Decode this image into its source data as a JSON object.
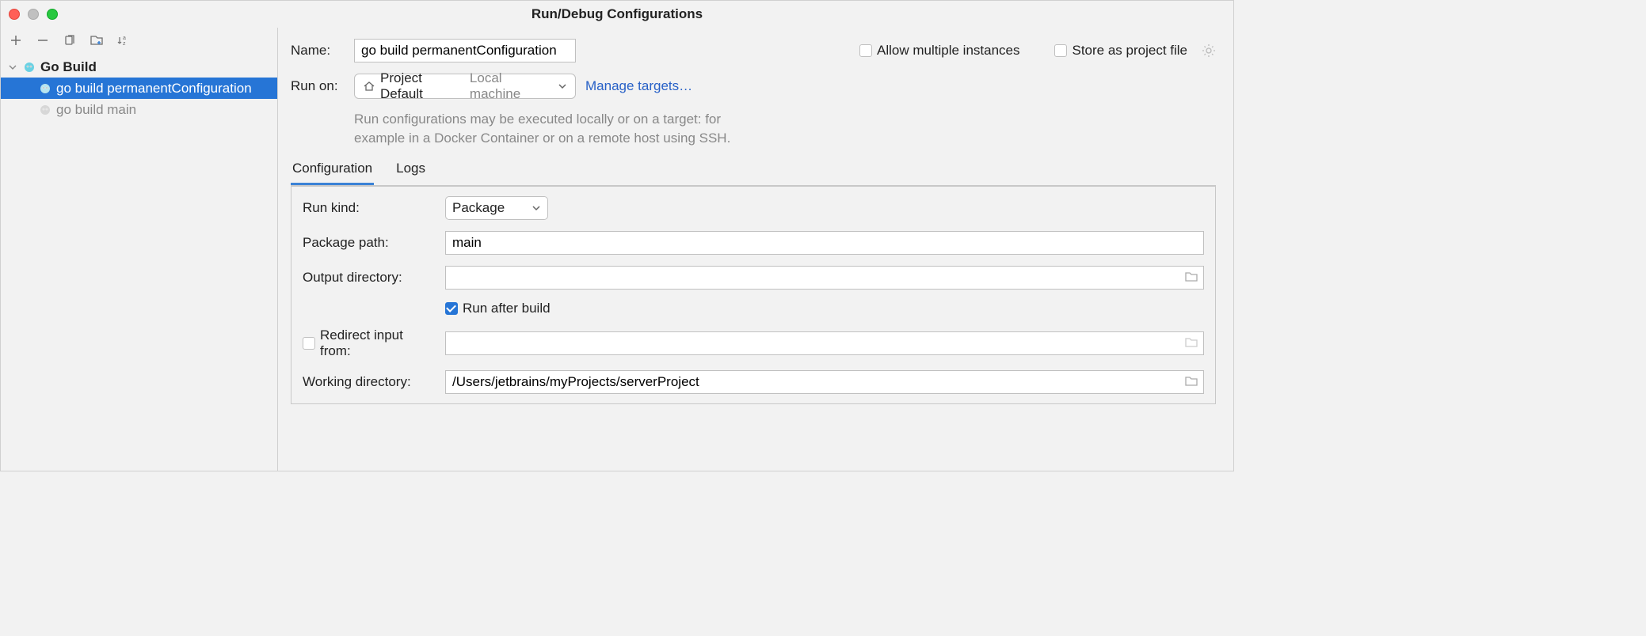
{
  "title": "Run/Debug Configurations",
  "sidebar": {
    "group": "Go Build",
    "items": [
      {
        "label": "go build permanentConfiguration",
        "selected": true
      },
      {
        "label": "go build main",
        "selected": false
      }
    ]
  },
  "form": {
    "name_label": "Name:",
    "name_value": "go build permanentConfiguration",
    "allow_multi": "Allow multiple instances",
    "store_project": "Store as project file",
    "run_on_label": "Run on:",
    "run_on_primary": "Project Default",
    "run_on_secondary": "Local machine",
    "manage_targets": "Manage targets…",
    "hint_l1": "Run configurations may be executed locally or on a target: for",
    "hint_l2": "example in a Docker Container or on a remote host using SSH."
  },
  "tabs": {
    "configuration": "Configuration",
    "logs": "Logs"
  },
  "config": {
    "run_kind_label": "Run kind:",
    "run_kind_value": "Package",
    "package_path_label": "Package path:",
    "package_path_value": "main",
    "output_dir_label": "Output directory:",
    "output_dir_value": "",
    "run_after_build": "Run after build",
    "redirect_input": "Redirect input from:",
    "redirect_input_value": "",
    "working_dir_label": "Working directory:",
    "working_dir_value": "/Users/jetbrains/myProjects/serverProject"
  }
}
